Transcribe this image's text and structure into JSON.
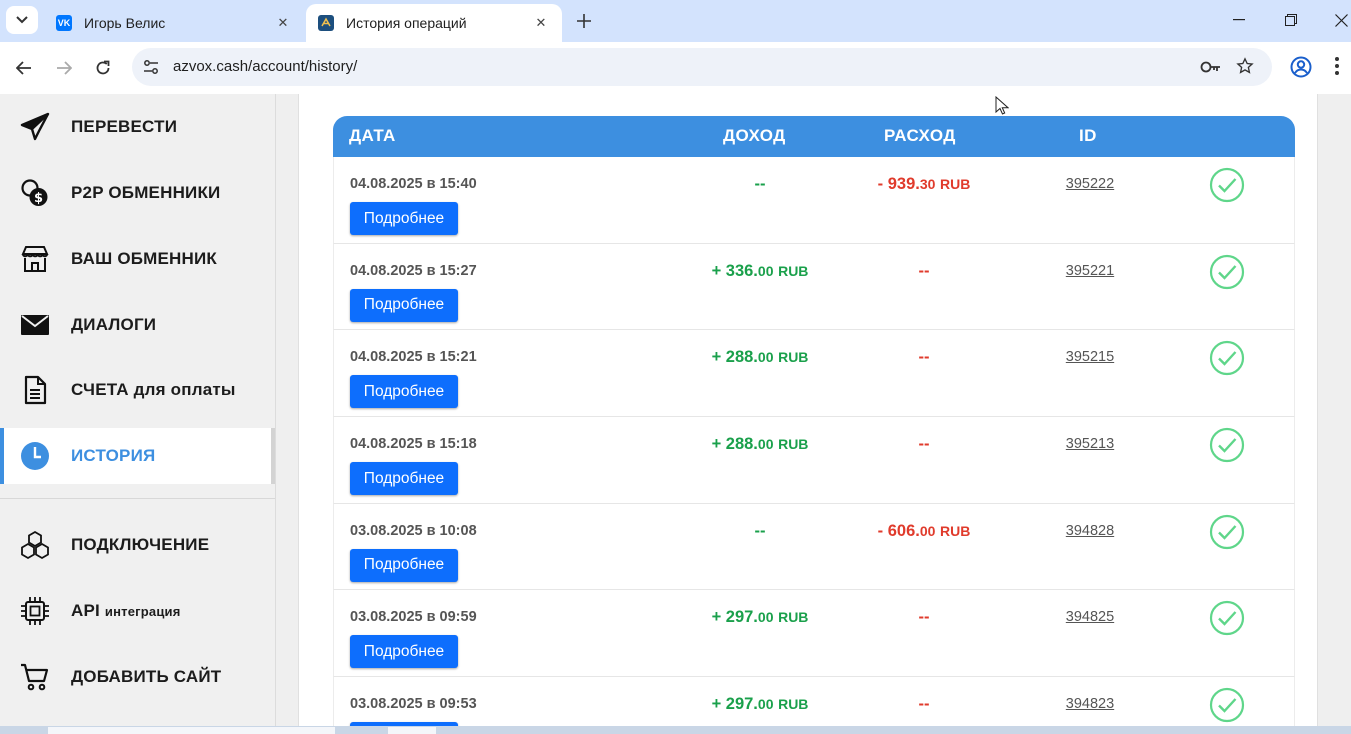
{
  "browser": {
    "tabs": [
      {
        "title": "Игорь Велис",
        "favicon": "vk-icon",
        "active": false
      },
      {
        "title": "История операций",
        "favicon": "azvox-icon",
        "active": true
      }
    ],
    "url": "azvox.cash/account/history/"
  },
  "sidebar": {
    "items": [
      {
        "label": "ПЕРЕВЕСТИ",
        "icon": "paper-plane-icon"
      },
      {
        "label": "P2P ОБМЕННИКИ",
        "icon": "coins-icon"
      },
      {
        "label": "ВАШ ОБМЕННИК",
        "icon": "store-icon"
      },
      {
        "label": "ДИАЛОГИ",
        "icon": "envelope-icon"
      },
      {
        "label": "СЧЕТА для оплаты",
        "icon": "document-icon"
      },
      {
        "label": "ИСТОРИЯ",
        "icon": "clock-icon",
        "active": true
      },
      {
        "label": "ПОДКЛЮЧЕНИЕ",
        "icon": "cubes-icon"
      },
      {
        "label": "API",
        "label_small": "интеграция",
        "icon": "chip-icon"
      },
      {
        "label": "ДОБАВИТЬ САЙТ",
        "icon": "cart-icon"
      }
    ]
  },
  "history": {
    "headers": {
      "date": "ДАТА",
      "income": "ДОХОД",
      "expense": "РАСХОД",
      "id": "ID"
    },
    "details_label": "Подробнее",
    "currency": "RUB",
    "rows": [
      {
        "date": "04.08.2025 в 15:40",
        "income": "--",
        "expense": "- 939.",
        "expense_cents": "30",
        "id": "395222",
        "status": "success"
      },
      {
        "date": "04.08.2025 в 15:27",
        "income": "+ 336.",
        "income_cents": "00",
        "expense": "--",
        "id": "395221",
        "status": "success"
      },
      {
        "date": "04.08.2025 в 15:21",
        "income": "+ 288.",
        "income_cents": "00",
        "expense": "--",
        "id": "395215",
        "status": "success"
      },
      {
        "date": "04.08.2025 в 15:18",
        "income": "+ 288.",
        "income_cents": "00",
        "expense": "--",
        "id": "395213",
        "status": "success"
      },
      {
        "date": "03.08.2025 в 10:08",
        "income": "--",
        "expense": "- 606.",
        "expense_cents": "00",
        "id": "394828",
        "status": "success"
      },
      {
        "date": "03.08.2025 в 09:59",
        "income": "+ 297.",
        "income_cents": "00",
        "expense": "--",
        "id": "394825",
        "status": "success"
      },
      {
        "date": "03.08.2025 в 09:53",
        "income": "+ 297.",
        "income_cents": "00",
        "expense": "--",
        "id": "394823",
        "status": "success"
      }
    ]
  },
  "colors": {
    "accent": "#3d8fe0",
    "button": "#0d6efd",
    "income": "#1aa04b",
    "expense": "#e03b2c",
    "check": "#5fd68a"
  }
}
